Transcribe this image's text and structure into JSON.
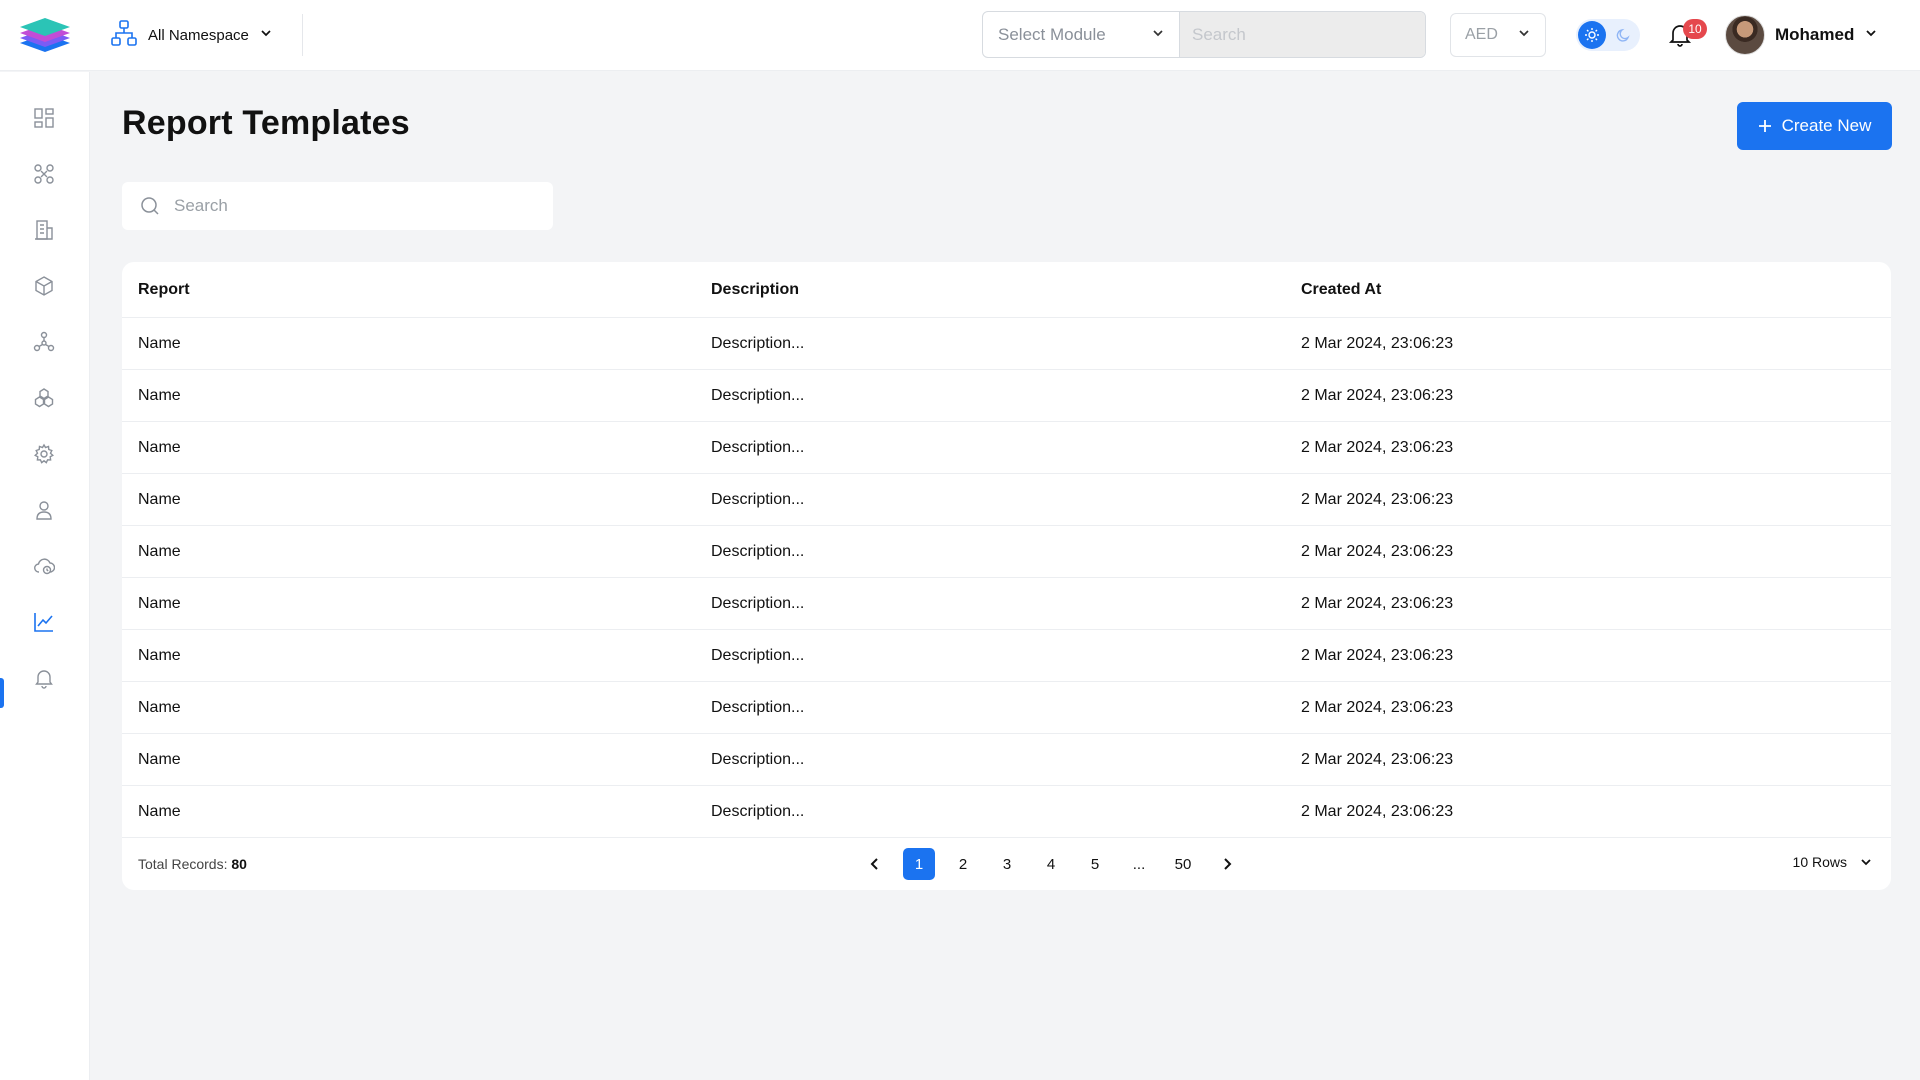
{
  "header": {
    "namespace_label": "All Namespace",
    "module_placeholder": "Select Module",
    "search_placeholder": "Search",
    "currency": "AED",
    "notification_count": "10",
    "user_name": "Mohamed"
  },
  "sidebar": {
    "items": [
      {
        "icon": "dashboard-icon"
      },
      {
        "icon": "nodes-icon"
      },
      {
        "icon": "building-icon"
      },
      {
        "icon": "cube-icon"
      },
      {
        "icon": "network-icon"
      },
      {
        "icon": "clusters-icon"
      },
      {
        "icon": "gear-icon"
      },
      {
        "icon": "user-icon"
      },
      {
        "icon": "cloud-icon"
      },
      {
        "icon": "chart-icon",
        "active": true
      },
      {
        "icon": "bell-icon"
      }
    ]
  },
  "page": {
    "title": "Report Templates",
    "create_label": "Create New",
    "search_placeholder": "Search"
  },
  "table": {
    "columns": [
      "Report",
      "Description",
      "Created At"
    ],
    "rows": [
      [
        "Name",
        "Description...",
        "2 Mar 2024, 23:06:23"
      ],
      [
        "Name",
        "Description...",
        "2 Mar 2024, 23:06:23"
      ],
      [
        "Name",
        "Description...",
        "2 Mar 2024, 23:06:23"
      ],
      [
        "Name",
        "Description...",
        "2 Mar 2024, 23:06:23"
      ],
      [
        "Name",
        "Description...",
        "2 Mar 2024, 23:06:23"
      ],
      [
        "Name",
        "Description...",
        "2 Mar 2024, 23:06:23"
      ],
      [
        "Name",
        "Description...",
        "2 Mar 2024, 23:06:23"
      ],
      [
        "Name",
        "Description...",
        "2 Mar 2024, 23:06:23"
      ],
      [
        "Name",
        "Description...",
        "2 Mar 2024, 23:06:23"
      ],
      [
        "Name",
        "Description...",
        "2 Mar 2024, 23:06:23"
      ]
    ]
  },
  "footer": {
    "total_label": "Total Records:",
    "total_value": "80",
    "pages": [
      "1",
      "2",
      "3",
      "4",
      "5",
      "...",
      "50"
    ],
    "current_page": "1",
    "rows_label": "10 Rows"
  },
  "colors": {
    "accent": "#1b73f0",
    "badge": "#e5484d",
    "background": "#f3f4f6"
  }
}
